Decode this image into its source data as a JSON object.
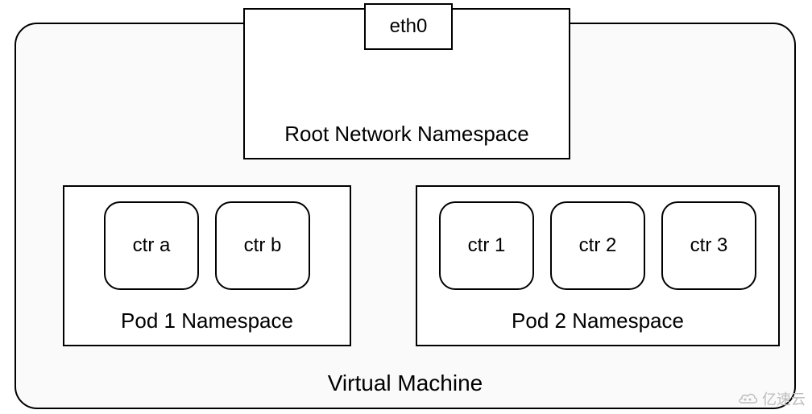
{
  "vm": {
    "label": "Virtual Machine"
  },
  "rootNamespace": {
    "label": "Root Network Namespace",
    "interface": "eth0"
  },
  "pod1": {
    "label": "Pod 1 Namespace",
    "containers": [
      "ctr a",
      "ctr b"
    ]
  },
  "pod2": {
    "label": "Pod 2 Namespace",
    "containers": [
      "ctr 1",
      "ctr 2",
      "ctr 3"
    ]
  },
  "watermark": {
    "text": "亿速云"
  }
}
